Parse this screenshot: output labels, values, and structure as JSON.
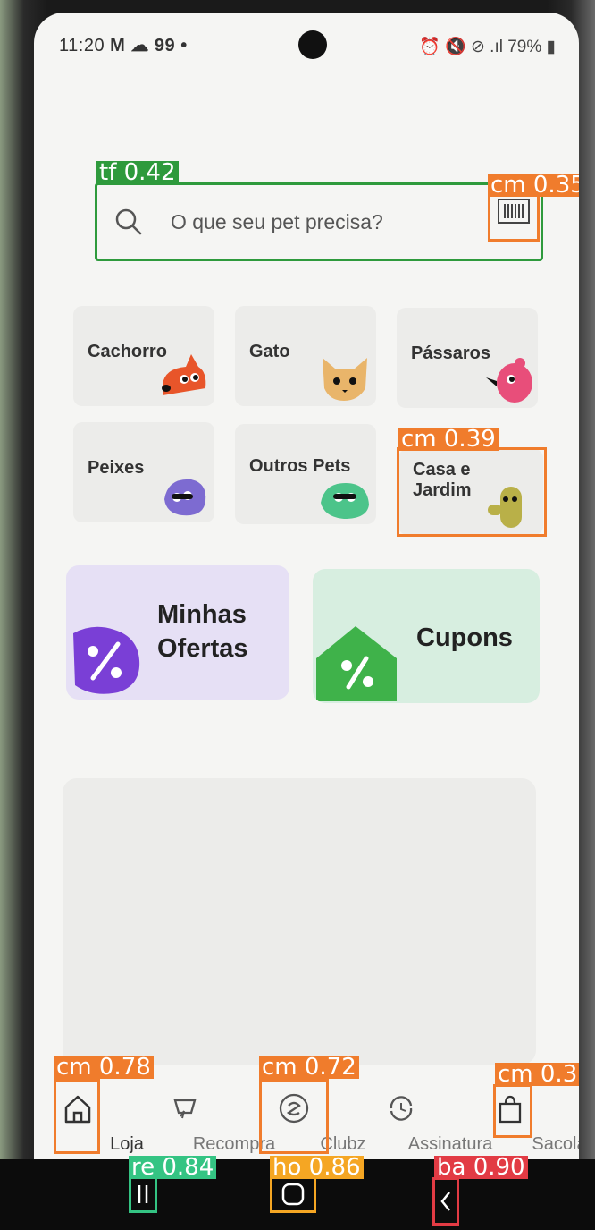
{
  "status": {
    "time": "11:20",
    "icons_left": "M ☁ 99 •",
    "battery": "79%"
  },
  "search": {
    "placeholder": "O que seu pet precisa?",
    "detection": "tf 0.42",
    "barcode_detection": "cm 0.35"
  },
  "categories": [
    {
      "label": "Cachorro",
      "art": "dog-icon",
      "color": "#e8552a"
    },
    {
      "label": "Gato",
      "art": "cat-icon",
      "color": "#e9b56a"
    },
    {
      "label": "Pássaros",
      "art": "bird-icon",
      "color": "#e84e7a"
    },
    {
      "label": "Peixes",
      "art": "fish-icon",
      "color": "#7d6bd1"
    },
    {
      "label": "Outros Pets",
      "art": "other-pets-icon",
      "color": "#4cc48a"
    },
    {
      "label": "Casa e Jardim",
      "art": "cactus-icon",
      "color": "#b9b048",
      "detection": "cm 0.39"
    }
  ],
  "promos": [
    {
      "title": "Minhas Ofertas",
      "bg": "#e6e0f5",
      "accent": "#7a3fd6"
    },
    {
      "title": "Cupons",
      "bg": "#d7eee0",
      "accent": "#3fb24a"
    }
  ],
  "nav": [
    {
      "label": "Loja",
      "icon": "home-icon",
      "detection": "cm 0.78"
    },
    {
      "label": "Recompra",
      "icon": "repurchase-icon"
    },
    {
      "label": "Clubz",
      "icon": "clubz-icon",
      "detection": "cm 0.72"
    },
    {
      "label": "Assinatura",
      "icon": "subscription-icon"
    },
    {
      "label": "Sacola",
      "icon": "bag-icon",
      "detection": "cm 0.3"
    }
  ],
  "system_nav": {
    "recents_detection": "re 0.84",
    "home_detection": "ho 0.86",
    "back_detection": "ba 0.90"
  }
}
